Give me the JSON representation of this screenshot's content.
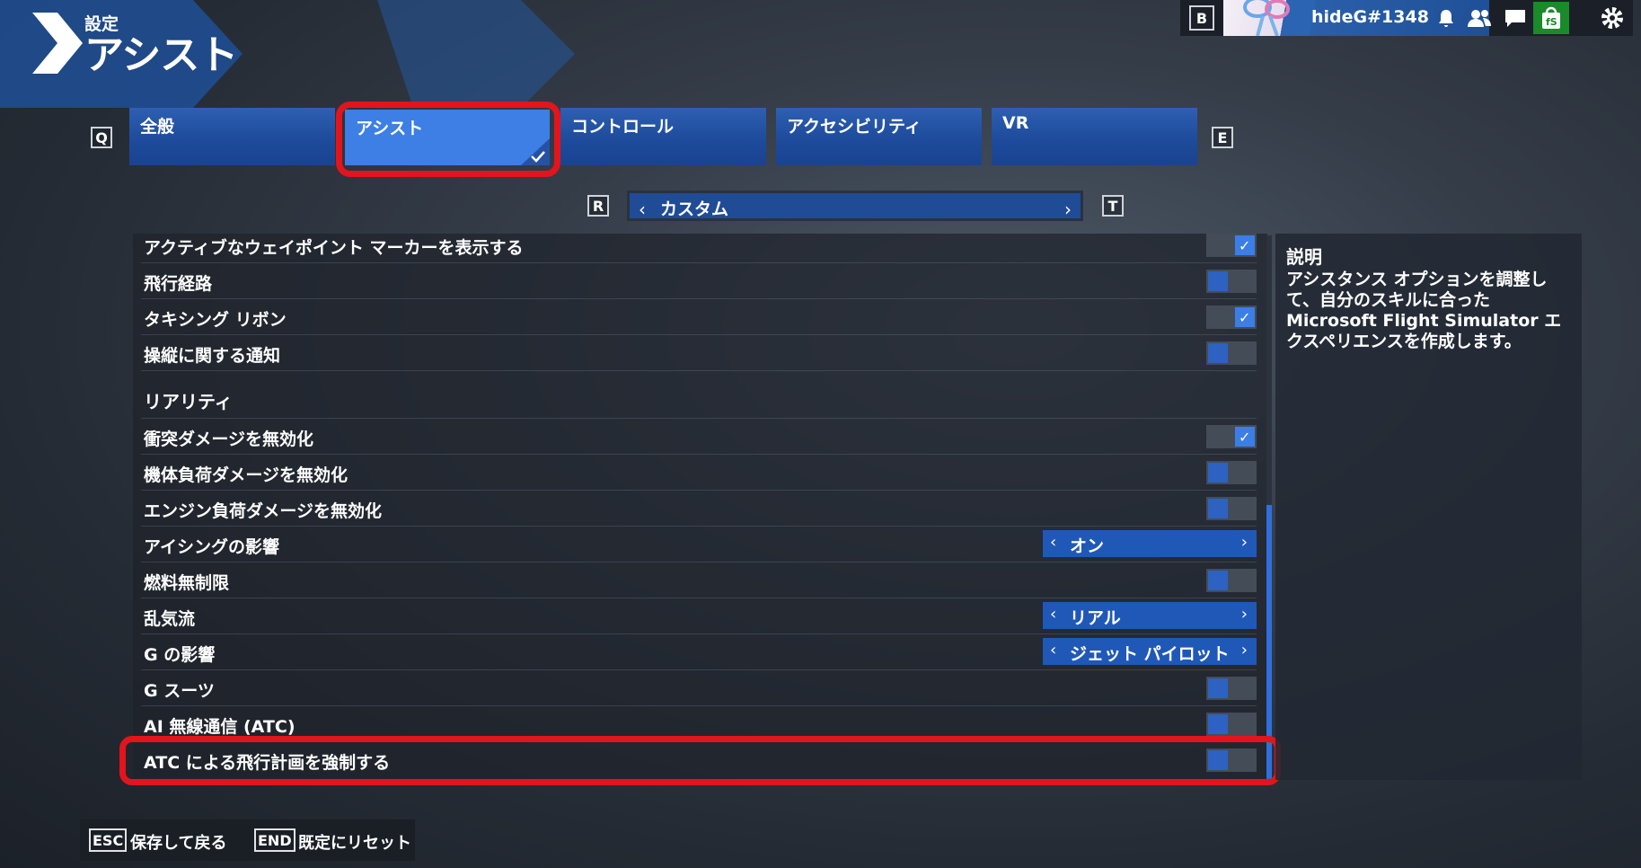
{
  "header": {
    "subtitle": "設定",
    "title": "アシスト"
  },
  "topbar": {
    "key": "B",
    "username": "hideG#1348"
  },
  "tabs": {
    "key_prev": "Q",
    "key_next": "E",
    "items": [
      {
        "label": "全般"
      },
      {
        "label": "アシスト"
      },
      {
        "label": "コントロール"
      },
      {
        "label": "アクセシビリティ"
      },
      {
        "label": "VR"
      }
    ]
  },
  "preset": {
    "key_prev": "R",
    "key_next": "T",
    "value": "カスタム"
  },
  "settings": {
    "rows_top": [
      {
        "label": "アクティブなウェイポイント マーカーを表示する",
        "state": "on"
      },
      {
        "label": "飛行経路",
        "state": "off"
      },
      {
        "label": "タキシング リボン",
        "state": "on"
      },
      {
        "label": "操縦に関する通知",
        "state": "off"
      }
    ],
    "section_title": "リアリティ",
    "rows": [
      {
        "label": "衝突ダメージを無効化",
        "type": "toggle",
        "state": "on"
      },
      {
        "label": "機体負荷ダメージを無効化",
        "type": "toggle",
        "state": "off"
      },
      {
        "label": "エンジン負荷ダメージを無効化",
        "type": "toggle",
        "state": "off"
      },
      {
        "label": "アイシングの影響",
        "type": "select",
        "value": "オン"
      },
      {
        "label": "燃料無制限",
        "type": "toggle",
        "state": "off"
      },
      {
        "label": "乱気流",
        "type": "select",
        "value": "リアル"
      },
      {
        "label": "G の影響",
        "type": "select",
        "value": "ジェット パイロット"
      },
      {
        "label": "G スーツ",
        "type": "toggle",
        "state": "off"
      },
      {
        "label": "AI 無線通信 (ATC)",
        "type": "toggle",
        "state": "off"
      },
      {
        "label": "ATC による飛行計画を強制する",
        "type": "toggle",
        "state": "off"
      }
    ]
  },
  "description": {
    "title": "説明",
    "text": "アシスタンス オプションを調整して、自分のスキルに合った Microsoft Flight Simulator エクスペリエンスを作成します。"
  },
  "footer": {
    "esc_key": "ESC",
    "esc_label": "保存して戻る",
    "end_key": "END",
    "end_label": "既定にリセット"
  },
  "colors": {
    "accent": "#2e6fdc",
    "tab": "#1d4a9a",
    "active_tab": "#3d7fe4",
    "highlight": "#e3141c"
  },
  "icons": [
    "bell-icon",
    "friends-icon",
    "chat-icon",
    "shop-icon",
    "gear-icon",
    "check-icon",
    "chevron-left-icon",
    "chevron-right-icon"
  ]
}
